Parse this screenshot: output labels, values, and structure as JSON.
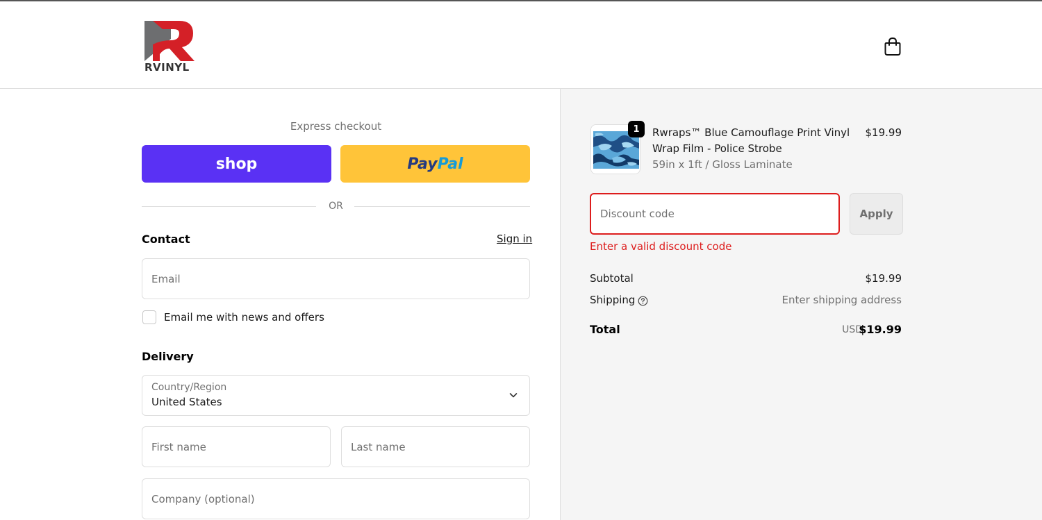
{
  "brand": {
    "name": "RVINYL",
    "logo_red": "#d42027",
    "logo_gray": "#6d6e70"
  },
  "header": {
    "cart_icon": "shopping-bag-icon"
  },
  "express": {
    "title": "Express checkout",
    "shop_label": "shop",
    "shop_color": "#5a31f4",
    "paypal_label_1": "Pay",
    "paypal_label_2": "Pal",
    "paypal_color": "#ffc439",
    "or_text": "OR"
  },
  "contact": {
    "title": "Contact",
    "sign_in": "Sign in",
    "email_placeholder": "Email",
    "newsletter_label": "Email me with news and offers"
  },
  "delivery": {
    "title": "Delivery",
    "country_label": "Country/Region",
    "country_value": "United States",
    "first_name_placeholder": "First name",
    "last_name_placeholder": "Last name",
    "company_placeholder": "Company (optional)"
  },
  "order": {
    "item": {
      "name": "Rwraps™ Blue Camouflage Print Vinyl Wrap Film - Police Strobe",
      "variant": "59in x 1ft / Gloss Laminate",
      "price": "$19.99",
      "quantity": "1"
    },
    "discount": {
      "placeholder": "Discount code",
      "apply_label": "Apply",
      "error": "Enter a valid discount code",
      "error_color": "#dd1d1d"
    },
    "summary": {
      "subtotal_label": "Subtotal",
      "subtotal_value": "$19.99",
      "shipping_label": "Shipping",
      "shipping_value": "Enter shipping address",
      "total_label": "Total",
      "currency": "USD",
      "total_value": "$19.99"
    }
  }
}
